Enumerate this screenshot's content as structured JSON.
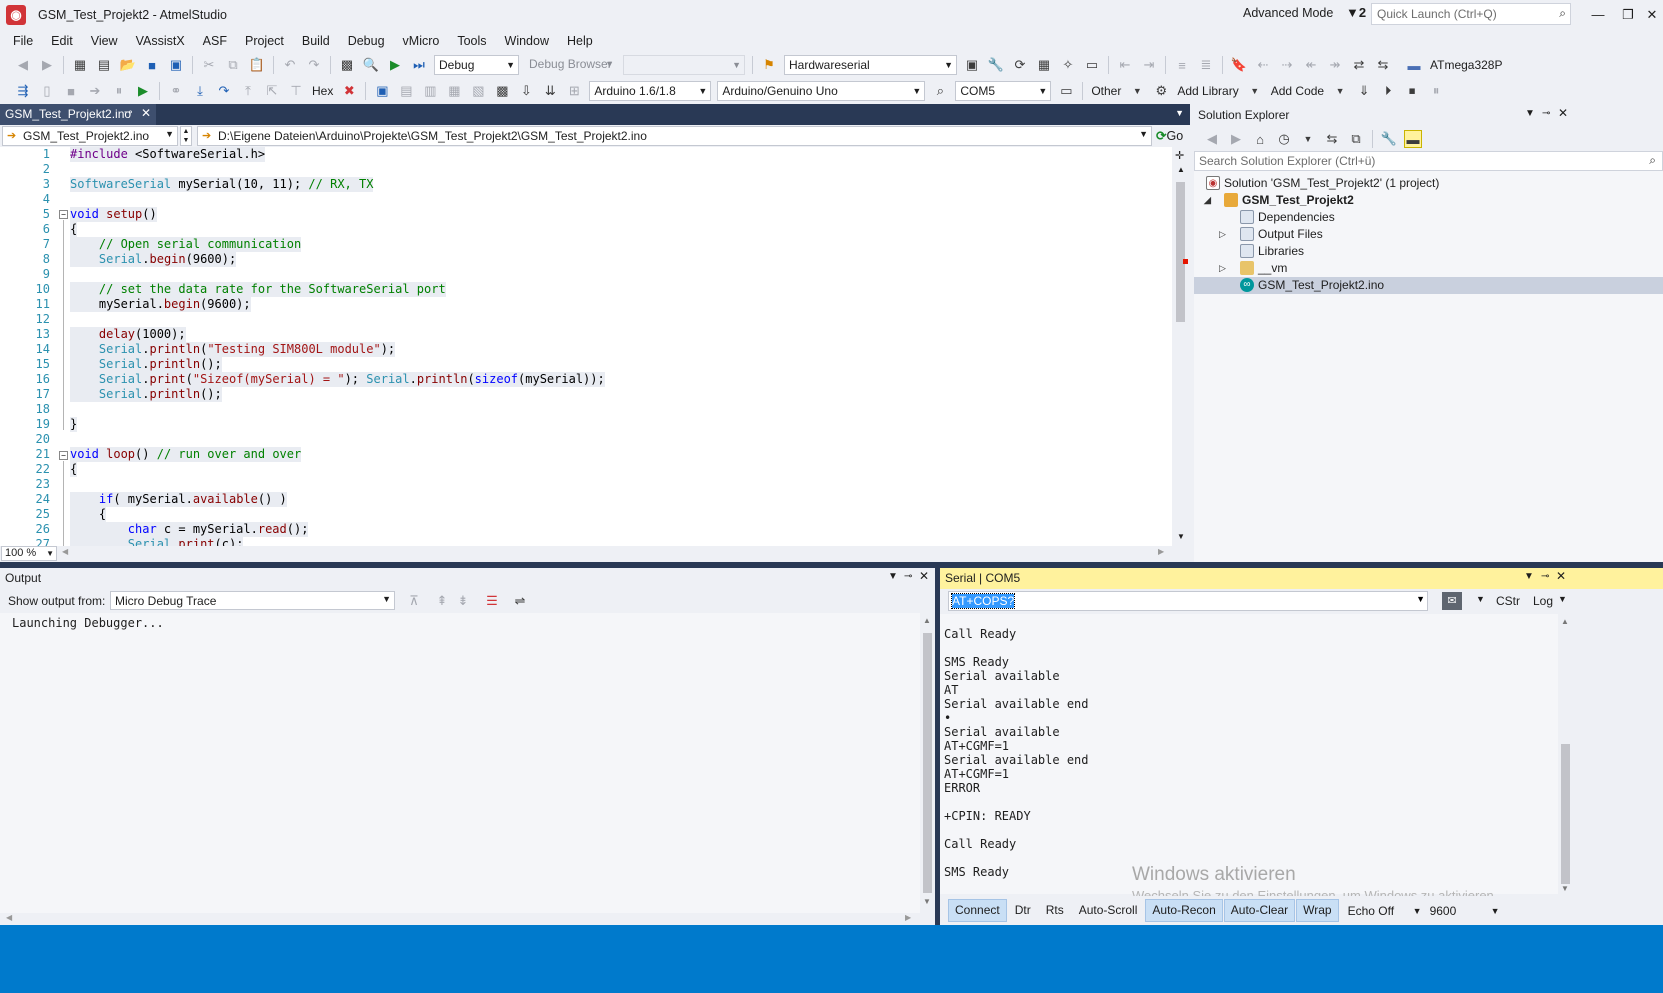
{
  "window": {
    "title": "GSM_Test_Projekt2 - AtmelStudio",
    "advanced_mode": "Advanced Mode",
    "filter_badge": "2",
    "quick_launch_placeholder": "Quick Launch (Ctrl+Q)"
  },
  "menu": [
    "File",
    "Edit",
    "View",
    "VAssistX",
    "ASF",
    "Project",
    "Build",
    "Debug",
    "vMicro",
    "Tools",
    "Window",
    "Help"
  ],
  "toolbar1": {
    "config": "Debug",
    "debug_browser": "Debug Browser",
    "find_combo": "Hardwareserial",
    "device": "ATmega328P"
  },
  "toolbar2": {
    "hex": "Hex",
    "ide_version": "Arduino 1.6/1.8",
    "board": "Arduino/Genuino Uno",
    "port": "COM5",
    "other": "Other",
    "add_library": "Add Library",
    "add_code": "Add Code"
  },
  "document": {
    "tab": "GSM_Test_Projekt2.ino",
    "nav_file": "GSM_Test_Projekt2.ino",
    "nav_path": "D:\\Eigene Dateien\\Arduino\\Projekte\\GSM_Test_Projekt2\\GSM_Test_Projekt2.ino",
    "go": "Go",
    "zoom": "100 %"
  },
  "code_lines": [
    [
      [
        "k-pre",
        "#include "
      ],
      [
        "k-plain",
        "<SoftwareSerial.h>"
      ]
    ],
    [],
    [
      [
        "k-type",
        "SoftwareSerial "
      ],
      [
        "k-plain",
        "mySerial(10, 11); "
      ],
      [
        "k-cm",
        "// RX, TX"
      ]
    ],
    [],
    [
      [
        "k-kw",
        "void "
      ],
      [
        "k-fn",
        "setup"
      ],
      [
        "k-plain",
        "()"
      ]
    ],
    [
      [
        "k-plain",
        "{"
      ]
    ],
    [
      [
        "k-plain",
        "    "
      ],
      [
        "k-cm",
        "// Open serial communication"
      ]
    ],
    [
      [
        "k-plain",
        "    "
      ],
      [
        "k-type",
        "Serial"
      ],
      [
        "k-plain",
        "."
      ],
      [
        "k-fn",
        "begin"
      ],
      [
        "k-plain",
        "(9600);"
      ]
    ],
    [],
    [
      [
        "k-plain",
        "    "
      ],
      [
        "k-cm",
        "// set the data rate for the SoftwareSerial port"
      ]
    ],
    [
      [
        "k-plain",
        "    mySerial."
      ],
      [
        "k-fn",
        "begin"
      ],
      [
        "k-plain",
        "(9600);"
      ]
    ],
    [],
    [
      [
        "k-plain",
        "    "
      ],
      [
        "k-fn",
        "delay"
      ],
      [
        "k-plain",
        "(1000);"
      ]
    ],
    [
      [
        "k-plain",
        "    "
      ],
      [
        "k-type",
        "Serial"
      ],
      [
        "k-plain",
        "."
      ],
      [
        "k-fn",
        "println"
      ],
      [
        "k-plain",
        "("
      ],
      [
        "k-str",
        "\"Testing SIM800L module\""
      ],
      [
        "k-plain",
        ");"
      ]
    ],
    [
      [
        "k-plain",
        "    "
      ],
      [
        "k-type",
        "Serial"
      ],
      [
        "k-plain",
        "."
      ],
      [
        "k-fn",
        "println"
      ],
      [
        "k-plain",
        "();"
      ]
    ],
    [
      [
        "k-plain",
        "    "
      ],
      [
        "k-type",
        "Serial"
      ],
      [
        "k-plain",
        "."
      ],
      [
        "k-fn",
        "print"
      ],
      [
        "k-plain",
        "("
      ],
      [
        "k-str",
        "\"Sizeof(mySerial) = \""
      ],
      [
        "k-plain",
        "); "
      ],
      [
        "k-type",
        "Serial"
      ],
      [
        "k-plain",
        "."
      ],
      [
        "k-fn",
        "println"
      ],
      [
        "k-plain",
        "("
      ],
      [
        "k-kw",
        "sizeof"
      ],
      [
        "k-plain",
        "(mySerial));"
      ]
    ],
    [
      [
        "k-plain",
        "    "
      ],
      [
        "k-type",
        "Serial"
      ],
      [
        "k-plain",
        "."
      ],
      [
        "k-fn",
        "println"
      ],
      [
        "k-plain",
        "();"
      ]
    ],
    [],
    [
      [
        "k-plain",
        "}"
      ]
    ],
    [],
    [
      [
        "k-kw",
        "void "
      ],
      [
        "k-fn",
        "loop"
      ],
      [
        "k-plain",
        "() "
      ],
      [
        "k-cm",
        "// run over and over"
      ]
    ],
    [
      [
        "k-plain",
        "{"
      ]
    ],
    [],
    [
      [
        "k-plain",
        "    "
      ],
      [
        "k-kw",
        "if"
      ],
      [
        "k-plain",
        "( mySerial."
      ],
      [
        "k-fn",
        "available"
      ],
      [
        "k-plain",
        "() )"
      ]
    ],
    [
      [
        "k-plain",
        "    {"
      ]
    ],
    [
      [
        "k-plain",
        "        "
      ],
      [
        "k-kw",
        "char "
      ],
      [
        "k-plain",
        "c = mySerial."
      ],
      [
        "k-fn",
        "read"
      ],
      [
        "k-plain",
        "();"
      ]
    ],
    [
      [
        "k-plain",
        "        "
      ],
      [
        "k-type",
        "Serial"
      ],
      [
        "k-plain",
        "."
      ],
      [
        "k-fn",
        "print"
      ],
      [
        "k-plain",
        "(c);"
      ]
    ]
  ],
  "solution_explorer": {
    "title": "Solution Explorer",
    "search_placeholder": "Search Solution Explorer (Ctrl+ü)",
    "items": [
      {
        "label": "Solution 'GSM_Test_Projekt2' (1 project)",
        "icon": "solution-icon"
      },
      {
        "label": "GSM_Test_Projekt2",
        "icon": "project-icon"
      },
      {
        "label": "Dependencies",
        "icon": "folder-icon"
      },
      {
        "label": "Output Files",
        "icon": "folder-icon"
      },
      {
        "label": "Libraries",
        "icon": "folder-icon"
      },
      {
        "label": "__vm",
        "icon": "folder-icon"
      },
      {
        "label": "GSM_Test_Projekt2.ino",
        "icon": "arduino-file-icon"
      }
    ]
  },
  "output": {
    "title": "Output",
    "show_from_label": "Show output from:",
    "source": "Micro Debug Trace",
    "text": "Launching Debugger..."
  },
  "serial": {
    "title": "Serial | COM5",
    "input": "AT+COPS?",
    "cstr": "CStr",
    "log": "Log",
    "text": "Call Ready\n\nSMS Ready\nSerial available\nAT\nSerial available end\n•\nSerial available\nAT+CGMF=1\nSerial available end\nAT+CGMF=1\nERROR\n\n+CPIN: READY\n\nCall Ready\n\nSMS Ready",
    "buttons": {
      "connect": "Connect",
      "dtr": "Dtr",
      "rts": "Rts",
      "autoscroll": "Auto-Scroll",
      "autorecon": "Auto-Recon",
      "autoclear": "Auto-Clear",
      "wrap": "Wrap"
    },
    "echo": "Echo Off",
    "baud": "9600"
  },
  "watermark": {
    "line1": "Windows aktivieren",
    "line2": "Wechseln Sie zu den Einstellungen, um Windows zu aktivieren."
  }
}
